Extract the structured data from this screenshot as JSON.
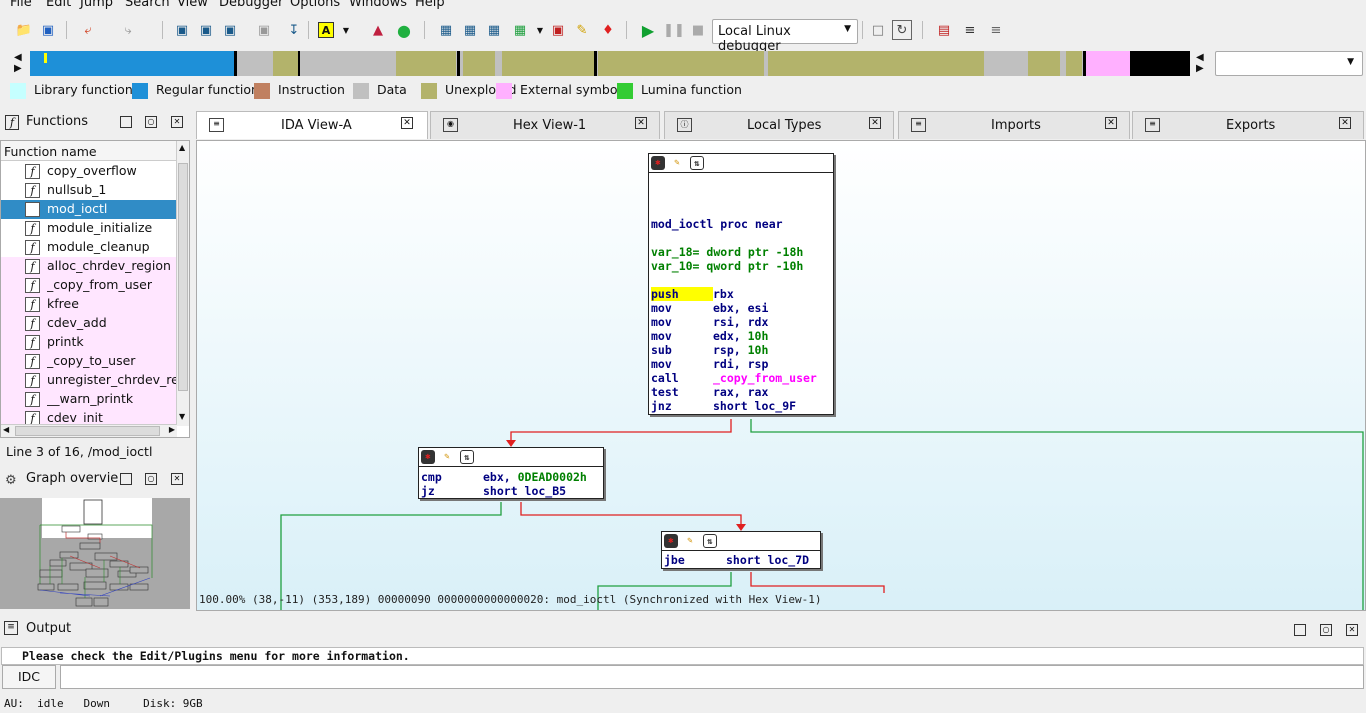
{
  "menu": [
    "File",
    "Edit",
    "Jump",
    "Search",
    "View",
    "Debugger",
    "Options",
    "Windows",
    "Help"
  ],
  "toolbar": {
    "debugger_select": "Local Linux debugger"
  },
  "legend": [
    {
      "label": "Library function",
      "color": "#c5ffff"
    },
    {
      "label": "Regular function",
      "color": "#1e90d8"
    },
    {
      "label": "Instruction",
      "color": "#c08060"
    },
    {
      "label": "Data",
      "color": "#c0c0c0"
    },
    {
      "label": "Unexplored",
      "color": "#b3b36b"
    },
    {
      "label": "External symbol",
      "color": "#ffb0ff"
    },
    {
      "label": "Lumina function",
      "color": "#33cc33"
    }
  ],
  "functions": {
    "title": "Functions",
    "header": "Function name",
    "items": [
      {
        "name": "copy_overflow",
        "kind": "regular"
      },
      {
        "name": "nullsub_1",
        "kind": "regular"
      },
      {
        "name": "mod_ioctl",
        "kind": "selected"
      },
      {
        "name": "module_initialize",
        "kind": "regular"
      },
      {
        "name": "module_cleanup",
        "kind": "regular"
      },
      {
        "name": "alloc_chrdev_region",
        "kind": "external"
      },
      {
        "name": "_copy_from_user",
        "kind": "external"
      },
      {
        "name": "kfree",
        "kind": "external"
      },
      {
        "name": "cdev_add",
        "kind": "external"
      },
      {
        "name": "printk",
        "kind": "external"
      },
      {
        "name": "_copy_to_user",
        "kind": "external"
      },
      {
        "name": "unregister_chrdev_region",
        "kind": "external"
      },
      {
        "name": "__warn_printk",
        "kind": "external"
      },
      {
        "name": "cdev_init",
        "kind": "external"
      }
    ],
    "status": "Line 3 of 16, /mod_ioctl"
  },
  "graph_overview": {
    "title": "Graph overvie"
  },
  "tabs": [
    {
      "label": "IDA View-A",
      "active": true
    },
    {
      "label": "Hex View-1",
      "active": false
    },
    {
      "label": "Local Types",
      "active": false
    },
    {
      "label": "Imports",
      "active": false
    },
    {
      "label": "Exports",
      "active": false
    }
  ],
  "graph": {
    "block1": {
      "proc": "mod_ioctl proc near",
      "vars": [
        [
          "var_18= ",
          "dword ptr -18h"
        ],
        [
          "var_10= ",
          "qword ptr -10h"
        ]
      ],
      "instrs": [
        [
          "push",
          "rbx",
          ""
        ],
        [
          "mov",
          "ebx, esi",
          ""
        ],
        [
          "mov",
          "rsi, rdx",
          ""
        ],
        [
          "mov",
          "edx, ",
          "10h"
        ],
        [
          "sub",
          "rsp, ",
          "10h"
        ],
        [
          "mov",
          "rdi, rsp",
          ""
        ],
        [
          "call",
          "",
          "_copy_from_user"
        ],
        [
          "test",
          "rax, rax",
          ""
        ],
        [
          "jnz",
          "short loc_9F",
          ""
        ]
      ]
    },
    "block2": {
      "instrs": [
        [
          "cmp",
          "ebx, ",
          "0DEAD0002h"
        ],
        [
          "jz",
          "short loc_B5",
          ""
        ]
      ]
    },
    "block3": {
      "instrs": [
        [
          "jbe",
          "short loc_7D",
          ""
        ]
      ]
    },
    "status": "100.00% (38,-11) (353,189) 00000090 0000000000000020: mod_ioctl (Synchronized with Hex View-1)"
  },
  "output": {
    "title": "Output",
    "text": "Please check the Edit/Plugins menu for more information.",
    "idc_label": "IDC"
  },
  "statusbar": "AU:  idle   Down     Disk: 9GB"
}
